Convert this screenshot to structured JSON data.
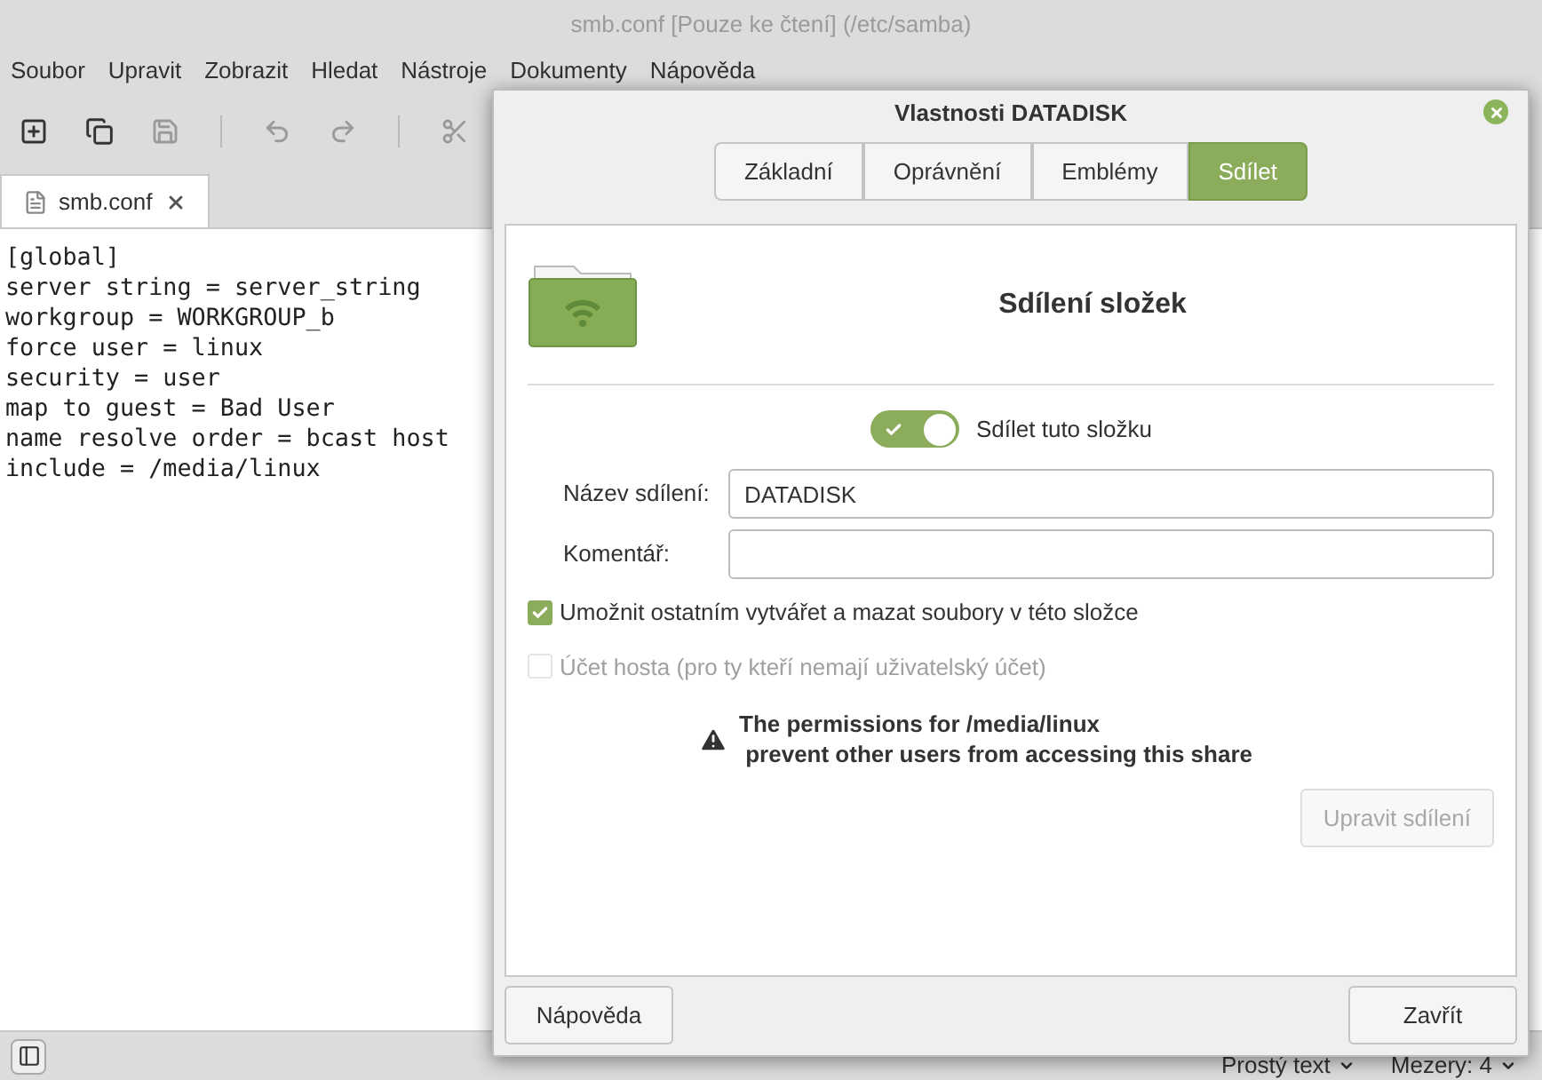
{
  "window": {
    "title": "smb.conf [Pouze ke čtení] (/etc/samba)"
  },
  "menu": [
    "Soubor",
    "Upravit",
    "Zobrazit",
    "Hledat",
    "Nástroje",
    "Dokumenty",
    "Nápověda"
  ],
  "tabs": [
    {
      "label": "smb.conf",
      "selected": true
    }
  ],
  "editor": {
    "lines": [
      "[global]",
      "server string = server_string",
      "workgroup = WORKGROUP_b",
      "force user = linux",
      "security = user",
      "map to guest = Bad User",
      "name resolve order = bcast host",
      "include = /media/linux"
    ]
  },
  "status_bar": [
    "Prostý text",
    "Mezery: 4"
  ],
  "dialog": {
    "title": "Vlastnosti DATADISK",
    "tabs": [
      {
        "label": "Základní",
        "selected": false
      },
      {
        "label": "Oprávnění",
        "selected": false
      },
      {
        "label": "Emblémy",
        "selected": false
      },
      {
        "label": "Sdílet",
        "selected": true
      }
    ],
    "heading": "Sdílení složek",
    "share_toggle": {
      "label": "Sdílet tuto složku",
      "on": true
    },
    "fields": [
      {
        "label": "Název sdílení:",
        "value": "DATADISK"
      },
      {
        "label": "Komentář:"
      }
    ],
    "checkboxes": [
      {
        "label": "Umožnit ostatním vytvářet a mazat soubory v této složce",
        "checked": true,
        "disabled": false
      },
      {
        "label": "Účet hosta (pro ty kteří nemají uživatelský účet)",
        "checked": false,
        "disabled": true
      }
    ],
    "warning": "The permissions for /media/linux\n prevent other users from accessing this share",
    "modify_button": {
      "label": "Upravit sdílení",
      "disabled": true
    },
    "help_button": "Nápověda",
    "close_button": "Zavřít"
  }
}
